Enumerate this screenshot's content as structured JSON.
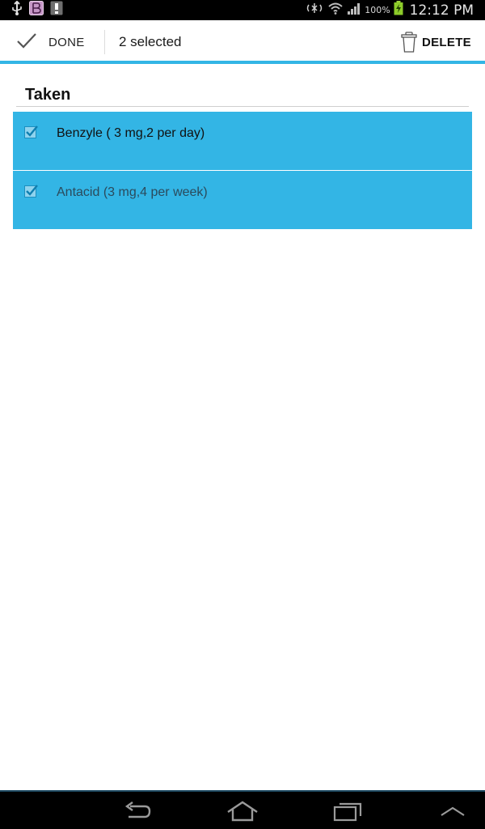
{
  "status_bar": {
    "time": "12:12 PM",
    "battery_percent": "100%"
  },
  "action_bar": {
    "done_label": "DONE",
    "selected_text": "2 selected",
    "delete_label": "DELETE"
  },
  "section": {
    "header": "Taken"
  },
  "items": [
    {
      "label": "Benzyle ( 3 mg,2 per day)",
      "checked": true
    },
    {
      "label": "Antacid (3 mg,4 per week)",
      "checked": true
    }
  ],
  "colors": {
    "accent": "#33b5e5",
    "status_bar": "#000000",
    "nav_bar": "#000000"
  },
  "icons": {
    "status_left": [
      "usb-icon",
      "app-notification-icon",
      "alert-icon"
    ],
    "status_right": [
      "nfc-icon",
      "wifi-icon",
      "signal-icon",
      "battery-charging-icon"
    ],
    "nav": [
      "back-icon",
      "home-icon",
      "recent-apps-icon",
      "menu-up-icon"
    ]
  }
}
